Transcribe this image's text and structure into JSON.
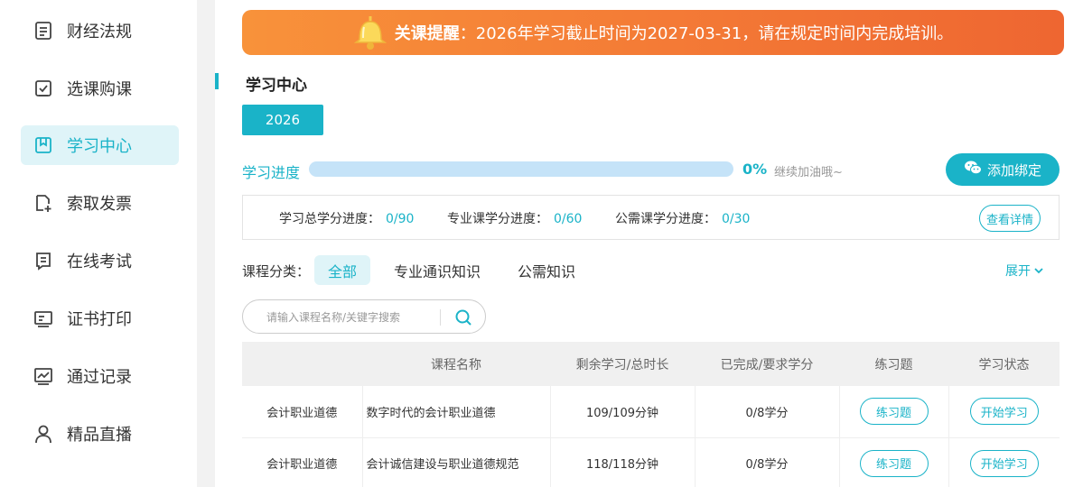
{
  "sidebar": {
    "items": [
      {
        "label": "财经法规",
        "icon": "document-icon"
      },
      {
        "label": "选课购课",
        "icon": "checkbox-icon"
      },
      {
        "label": "学习中心",
        "icon": "bookmark-icon",
        "active": true
      },
      {
        "label": "索取发票",
        "icon": "invoice-add-icon"
      },
      {
        "label": "在线考试",
        "icon": "exam-icon"
      },
      {
        "label": "证书打印",
        "icon": "certificate-icon"
      },
      {
        "label": "通过记录",
        "icon": "chart-icon"
      },
      {
        "label": "精品直播",
        "icon": "user-icon"
      }
    ]
  },
  "banner": {
    "strong": "关课提醒",
    "text": "：2026年学习截止时间为2027-03-31，请在规定时间内完成培训。",
    "icon": "bell-icon"
  },
  "section": {
    "title": "学习中心"
  },
  "year_tab": "2026",
  "progress": {
    "label": "学习进度",
    "percent_text": "0%",
    "value": 0,
    "hint": "继续加油哦~"
  },
  "bind_button": {
    "label": "添加绑定",
    "icon": "wechat-icon"
  },
  "credits": {
    "total": {
      "label": "学习总学分进度：",
      "value": "0/90"
    },
    "major": {
      "label": "专业课学分进度：",
      "value": "0/60"
    },
    "public": {
      "label": "公需课学分进度：",
      "value": "0/30"
    },
    "detail_label": "查看详情"
  },
  "category": {
    "label": "课程分类：",
    "tabs": [
      "全部",
      "专业通识知识",
      "公需知识"
    ],
    "expand_label": "展开"
  },
  "search": {
    "placeholder": "请输入课程名称/关键字搜索"
  },
  "table": {
    "headers": [
      "",
      "课程名称",
      "剩余学习/总时长",
      "已完成/要求学分",
      "练习题",
      "学习状态"
    ],
    "rows": [
      {
        "category": "会计职业道德",
        "name": "数字时代的会计职业道德",
        "duration": "109/109分钟",
        "credits": "0/8学分",
        "practice": "练习题",
        "status": "开始学习"
      },
      {
        "category": "会计职业道德",
        "name": "会计诚信建设与职业道德规范",
        "duration": "118/118分钟",
        "credits": "0/8学分",
        "practice": "练习题",
        "status": "开始学习"
      }
    ]
  },
  "colors": {
    "accent": "#1ab3c8",
    "banner": "#f47b36"
  }
}
